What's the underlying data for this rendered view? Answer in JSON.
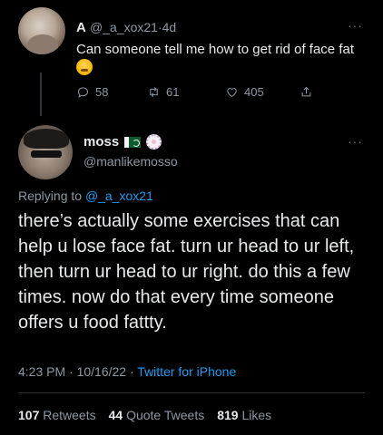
{
  "parent_tweet": {
    "name": "A",
    "handle": "@_a_xox21",
    "separator": "·",
    "time": "4d",
    "more": "···",
    "text": "Can someone tell me how to get rid of face fat",
    "emoji": "crying-laughing-face",
    "actions": {
      "replies": "58",
      "retweets": "61",
      "likes": "405"
    }
  },
  "main_tweet": {
    "name": "moss",
    "handle": "@manlikemosso",
    "more": "···",
    "replying_label": "Replying to",
    "replying_to": "@_a_xox21",
    "text": "there’s actually some exercises that can help u lose face fat. turn ur head to ur left, then turn ur head to ur right. do this a few times. now do that every time someone offers u food fattty.",
    "time": "4:23 PM",
    "date": "10/16/22",
    "separator": "·",
    "source": "Twitter for iPhone",
    "stats": {
      "retweets_count": "107",
      "retweets_label": "Retweets",
      "quotes_count": "44",
      "quotes_label": "Quote Tweets",
      "likes_count": "819",
      "likes_label": "Likes"
    }
  },
  "colors": {
    "background": "#000000",
    "text": "#e7e9ea",
    "muted": "#8b98a5",
    "link": "#1d9bf0"
  }
}
